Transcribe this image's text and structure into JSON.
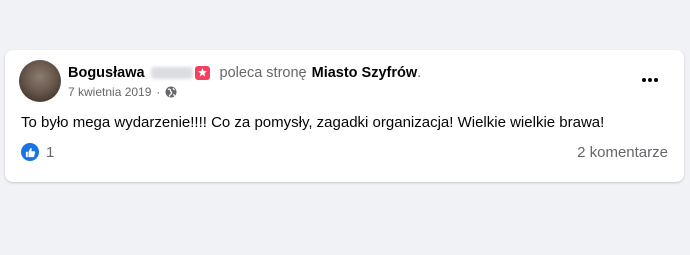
{
  "post": {
    "author_name": "Bogusława",
    "verb": "poleca stronę",
    "page_name": "Miasto Szyfrów",
    "period": ".",
    "date": "7 kwietnia 2019",
    "separator": "·",
    "privacy_icon": "globe-icon",
    "recommend_icon": "recommend-star-icon",
    "text": "To było mega wydarzenie!!!! Co za pomysły, zagadki organizacja! Wielkie wielkie brawa!"
  },
  "footer": {
    "reaction_icon": "like-icon",
    "reaction_count": "1",
    "comments_label": "2 komentarze"
  },
  "colors": {
    "background": "#f0f2f5",
    "card": "#ffffff",
    "like_blue": "#1b74e4",
    "recommend_red": "#f3425f",
    "secondary_text": "#65676b"
  }
}
